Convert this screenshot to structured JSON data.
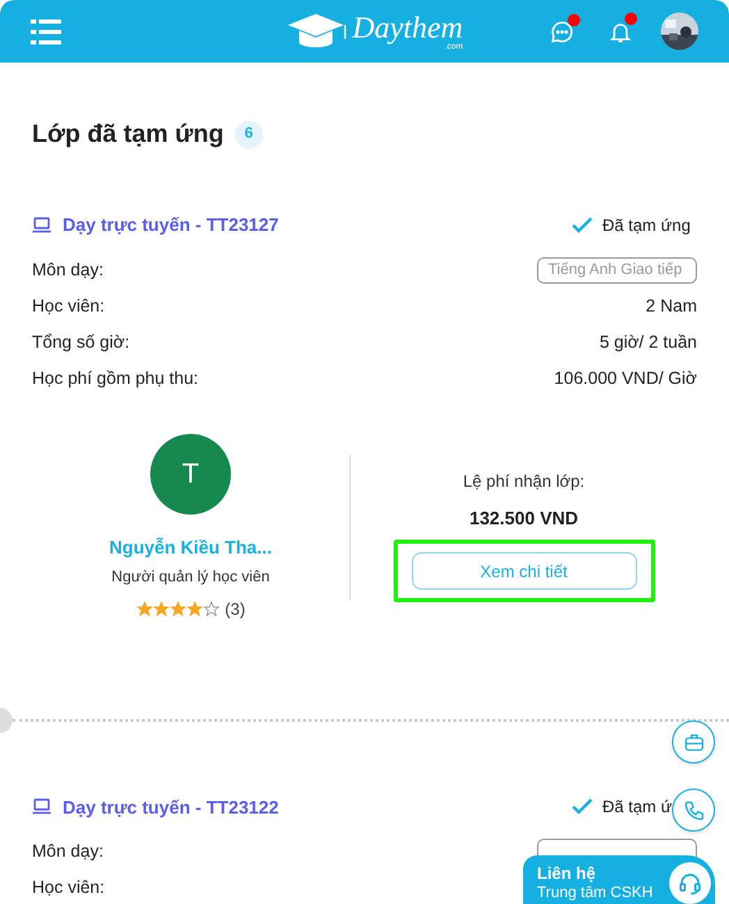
{
  "header": {
    "logo_text": "Daythem",
    "logo_suffix": ".com",
    "messages_unread": true,
    "notifications_unread": true
  },
  "page": {
    "title": "Lớp đã tạm ứng",
    "count": "6"
  },
  "classes": [
    {
      "title": "Dạy trực tuyến - TT23127",
      "status": "Đã tạm ứng",
      "advanced": true,
      "rows": [
        {
          "label": "Môn dạy:",
          "value": "Tiếng Anh Giao tiếp",
          "kind": "tag"
        },
        {
          "label": "Học viên:",
          "value": "2 Nam",
          "kind": "text"
        },
        {
          "label": "Tổng số giờ:",
          "value": "5 giờ/ 2 tuần",
          "kind": "text"
        },
        {
          "label": "Học phí gồm phụ thu:",
          "value": "106.000 VND/ Giờ",
          "kind": "text"
        }
      ],
      "manager": {
        "initial": "T",
        "name": "Nguyễn Kiều Tha...",
        "role": "Người quản lý học viên",
        "stars": 4,
        "reviews": "(3)"
      },
      "fee": {
        "label": "Lệ phí nhận lớp:",
        "amount": "132.500 VND",
        "button": "Xem chi tiết",
        "highlighted": true
      }
    },
    {
      "title": "Dạy trực tuyến - TT23122",
      "status": "Đã tạm ứ",
      "advanced": true,
      "rows": [
        {
          "label": "Môn dạy:",
          "kind": "tag"
        },
        {
          "label": "Học viên:",
          "kind": "text"
        }
      ]
    }
  ],
  "contact": {
    "title": "Liên hệ",
    "subtitle": "Trung tâm CSKH"
  }
}
